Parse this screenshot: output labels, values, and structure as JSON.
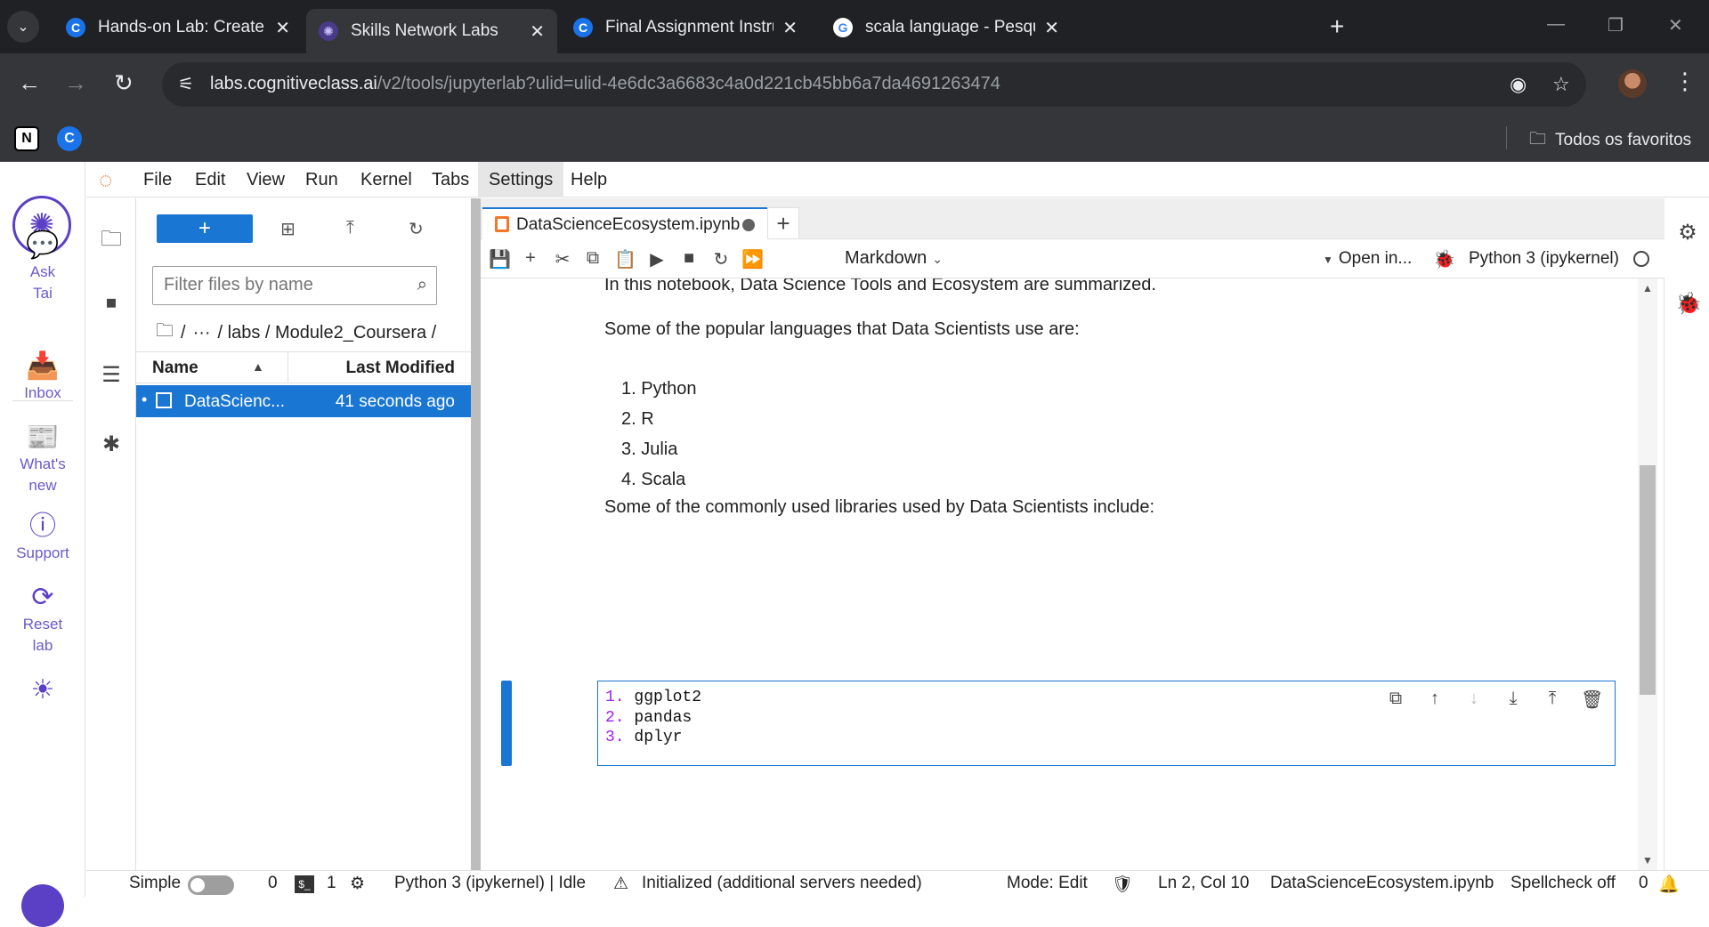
{
  "browser": {
    "tabs": [
      {
        "title": "Hands-on Lab: Create your Jupy",
        "favicon": "cognitiveclass-icon"
      },
      {
        "title": "Skills Network Labs",
        "favicon": "skills-network-icon",
        "active": true
      },
      {
        "title": "Final Assignment Instructions: C",
        "favicon": "cognitiveclass-icon"
      },
      {
        "title": "scala language - Pesquisa Goog",
        "favicon": "google-icon"
      }
    ],
    "url_host": "labs.cognitiveclass.ai",
    "url_path": "/v2/tools/jupyterlab?ulid=ulid-4e6dc3a6683c4a0d221cb45bb6a7da4691263474",
    "bookmarks_folder": "Todos os favoritos"
  },
  "sn_rail": {
    "items": [
      {
        "label_1": "Ask",
        "label_2": "Tai",
        "icon": "chat-bot-icon"
      },
      {
        "label_1": "Inbox",
        "label_2": "",
        "icon": "inbox-icon"
      },
      {
        "label_1": "What's",
        "label_2": "new",
        "icon": "news-icon"
      },
      {
        "label_1": "Support",
        "label_2": "",
        "icon": "help-icon"
      },
      {
        "label_1": "Reset",
        "label_2": "lab",
        "icon": "reset-icon"
      }
    ]
  },
  "menubar": {
    "items": [
      "File",
      "Edit",
      "View",
      "Run",
      "Kernel",
      "Tabs",
      "Settings",
      "Help"
    ]
  },
  "filebrowser": {
    "new_button": "+",
    "filter_placeholder": "Filter files by name",
    "breadcrumb": {
      "ellipsis": "···",
      "path": "/ labs / Module2_Coursera /",
      "root_sep": "/"
    },
    "columns": {
      "name": "Name",
      "modified": "Last Modified"
    },
    "files": [
      {
        "name": "DataScienc...",
        "modified": "41 seconds ago",
        "selected": true
      }
    ]
  },
  "notebook": {
    "tab_title": "DataScienceEcosystem.ipynb",
    "cell_type": "Markdown",
    "open_in": "Open in...",
    "kernel": "Python 3 (ipykernel)",
    "md_line_1": "In this notebook, Data Science Tools and Ecosystem are summarized.",
    "md_line_2": "Some of the popular languages that Data Scientists use are:",
    "languages": [
      "1. Python",
      "2. R",
      "3. Julia",
      "4. Scala"
    ],
    "md_line_3": "Some of the commonly used libraries used by Data Scientists include:",
    "editor_lines": [
      {
        "num": "1.",
        "text": "ggplot2"
      },
      {
        "num": "2.",
        "text": "pandas"
      },
      {
        "num": "3.",
        "text": "dplyr"
      }
    ]
  },
  "status": {
    "mode_label": "Simple",
    "terminals": "0",
    "kernels": "1",
    "kernel_status": "Python 3 (ipykernel) | Idle",
    "lsp": "Initialized (additional servers needed)",
    "edit_mode": "Mode: Edit",
    "cursor": "Ln 2, Col 10",
    "file": "DataScienceEcosystem.ipynb",
    "spellcheck": "Spellcheck off",
    "notifications": "0"
  },
  "colors": {
    "accent": "#1976d2",
    "brand": "#5b3fc4",
    "jupyter_orange": "#f37726",
    "chrome_dark": "#202124"
  }
}
